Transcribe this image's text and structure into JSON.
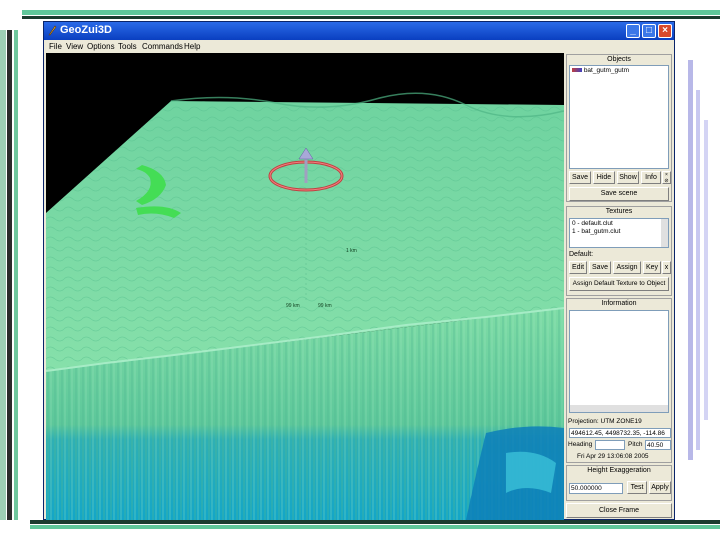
{
  "window": {
    "title": "GeoZui3D"
  },
  "menu": [
    "File",
    "View",
    "Options",
    "Tools",
    "Commands",
    "Help"
  ],
  "objects": {
    "header": "Objects",
    "items": [
      "bat_gutm_gutm"
    ],
    "buttons": {
      "save": "Save",
      "hide": "Hide",
      "show": "Show",
      "info": "Info",
      "save_scene": "Save scene"
    }
  },
  "textures": {
    "header": "Textures",
    "items": [
      "0 - default.clut",
      "1 - bat_gutm.clut"
    ],
    "default_label": "Default:",
    "buttons": {
      "edit": "Edit",
      "save": "Save",
      "assign": "Assign",
      "key": "Key",
      "x": "x",
      "assign_default": "Assign Default Texture to Object"
    }
  },
  "information": {
    "header": "Information",
    "projection": "Projection: UTM ZONE19",
    "coords": "494612.45, 4498732.35, -114.86",
    "heading_label": "Heading",
    "heading_value": "",
    "pitch_label": "Pitch",
    "pitch_value": "40.50",
    "datetime": "Fri Apr 29 13:06:08 2005"
  },
  "height": {
    "header": "Height Exaggeration",
    "value": "50.000000",
    "test": "Test",
    "apply": "Apply"
  },
  "close_frame": "Close Frame",
  "scene_labels": [
    "1 km",
    "99 km",
    "99 km"
  ],
  "colors": {
    "titlebar": "#0a3fc0",
    "terrain": "#7ed9a3",
    "deep": "#1aa6c4",
    "frame": "#ece9d8"
  }
}
